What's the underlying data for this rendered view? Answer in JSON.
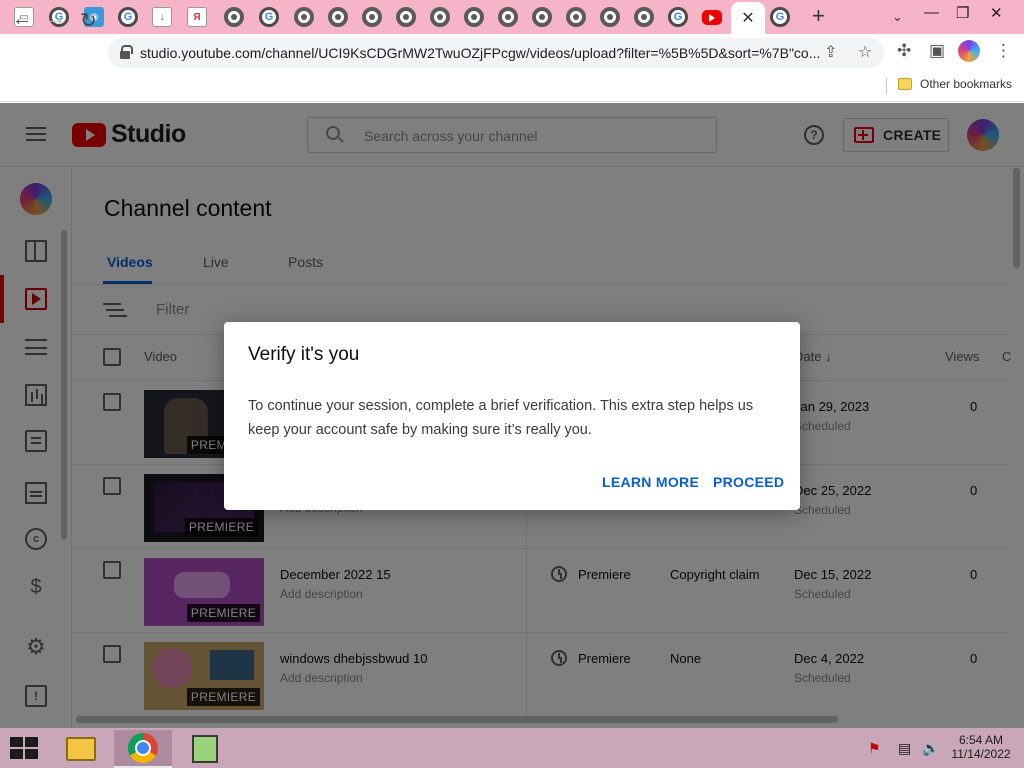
{
  "browser": {
    "active_tab_close": "✕",
    "new_tab": "+",
    "url": "studio.youtube.com/channel/UCI9KsCDGrMW2TwuOZjFPcgw/videos/upload?filter=%5B%5D&sort=%7B\"co...",
    "bookmarks": {
      "other_label": "Other bookmarks"
    }
  },
  "studio": {
    "logo_text": "Studio",
    "search_placeholder": "Search across your channel",
    "help_glyph": "?",
    "create_label": "CREATE"
  },
  "content": {
    "title": "Channel content",
    "tabs": [
      {
        "label": "Videos",
        "active": true
      },
      {
        "label": "Live",
        "active": false
      },
      {
        "label": "Posts",
        "active": false
      }
    ],
    "filter_label": "Filter",
    "columns": {
      "video": "Video",
      "date": "Date ↓",
      "views": "Views",
      "cut": "C"
    },
    "rows": [
      {
        "title": "",
        "description": "",
        "badge": "PREMIERE",
        "visibility": "",
        "restrictions": "",
        "date": "Jan 29, 2023",
        "status": "Scheduled",
        "views": "0",
        "thumb_color": "#2a2d3a"
      },
      {
        "title": "",
        "description": "Add description",
        "badge": "PREMIERE",
        "visibility": "",
        "restrictions": "",
        "date": "Dec 25, 2022",
        "status": "Scheduled",
        "views": "0",
        "thumb_color": "#3a1f4d"
      },
      {
        "title": "December 2022 15",
        "description": "Add description",
        "badge": "PREMIERE",
        "visibility": "Premiere",
        "restrictions": "Copyright claim",
        "date": "Dec 15, 2022",
        "status": "Scheduled",
        "views": "0",
        "thumb_color": "#b14fc4"
      },
      {
        "title": "windows dhebjssbwud 10",
        "description": "Add description",
        "badge": "PREMIERE",
        "visibility": "Premiere",
        "restrictions": "None",
        "date": "Dec 4, 2022",
        "status": "Scheduled",
        "views": "0",
        "thumb_color": "#c9a66b"
      }
    ]
  },
  "dialog": {
    "title": "Verify it's you",
    "body": "To continue your session, complete a brief verification. This extra step helps us keep your account safe by making sure it’s really you.",
    "learn_more": "LEARN MORE",
    "proceed": "PROCEED"
  },
  "taskbar": {
    "time": "6:54 AM",
    "date": "11/14/2022"
  },
  "colors": {
    "tabstrip": "#f5b4c8",
    "accent_blue": "#065fd4",
    "youtube_red": "#ee0000",
    "taskbar": "#c9a7b8"
  }
}
